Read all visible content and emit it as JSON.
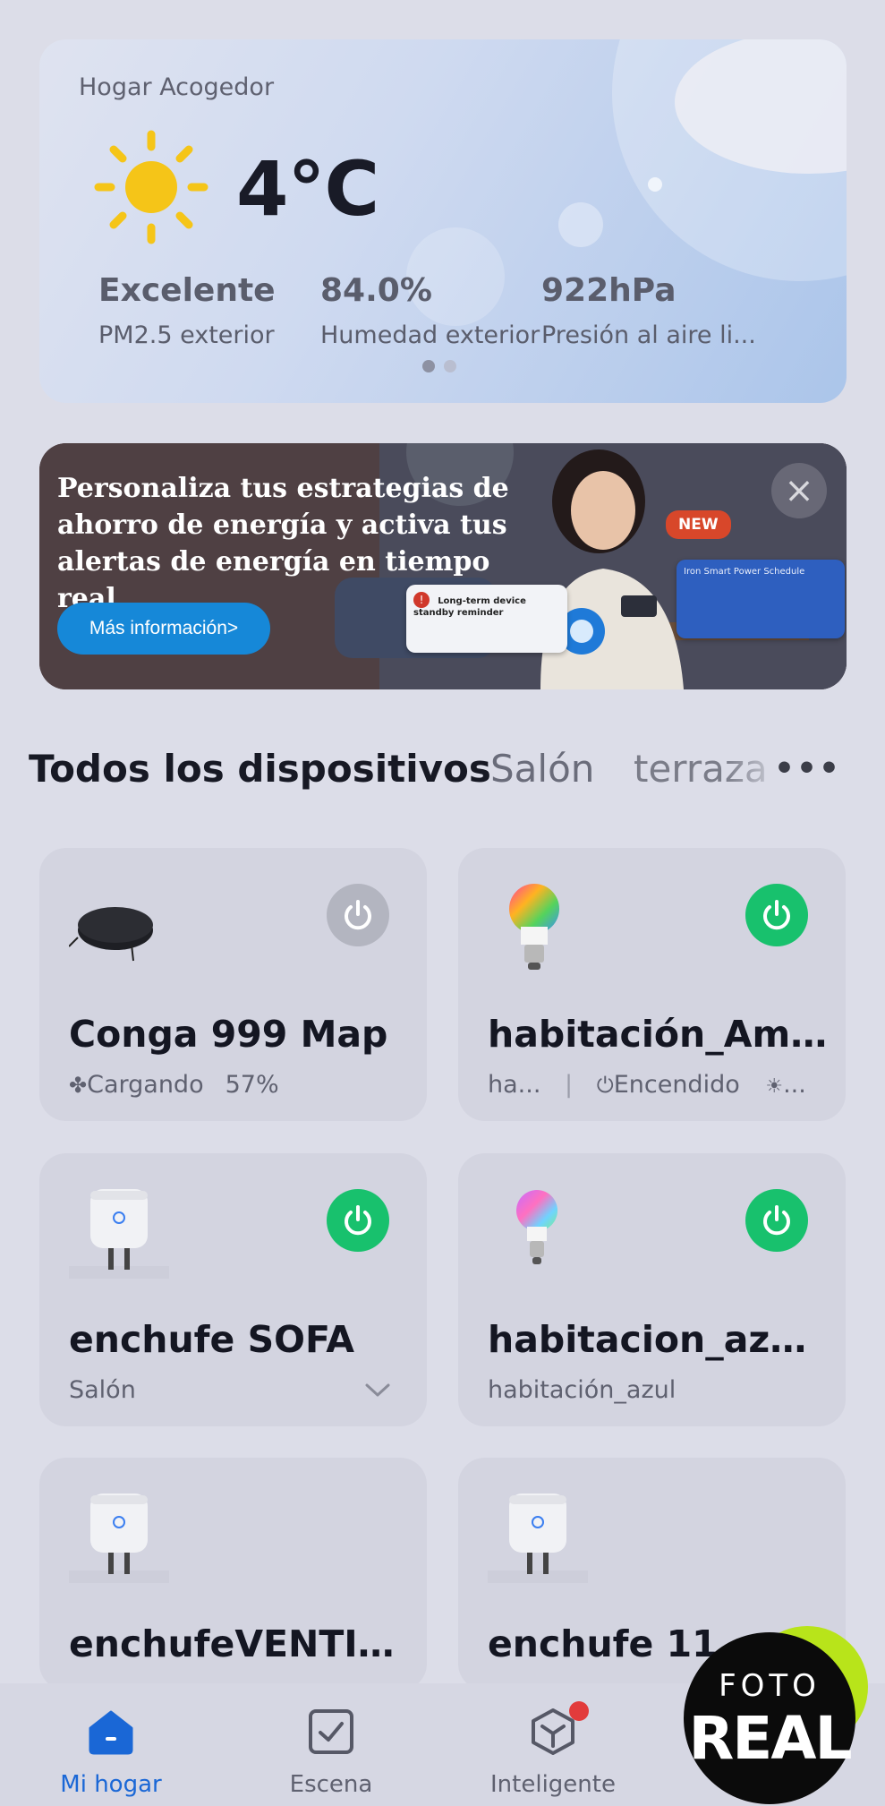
{
  "weather": {
    "home_name": "Hogar Acogedor",
    "temperature": "4°C",
    "icon": "sun-icon",
    "stats": [
      {
        "value": "Excelente",
        "label": "PM2.5 exterior"
      },
      {
        "value": "84.0%",
        "label": "Humedad exterior"
      },
      {
        "value": "922hPa",
        "label": "Presión al aire li..."
      }
    ],
    "page_dots": {
      "count": 2,
      "active": 0
    }
  },
  "banner": {
    "headline_lines": [
      "Personaliza tus estrategias de",
      "ahorro de energía y activa tus",
      "alertas de energía en tiempo real"
    ],
    "cta": "Más información>",
    "tag": "NEW",
    "mini_card_1": "Long-term device standby reminder",
    "mini_card_2": "Iron Smart Power Schedule"
  },
  "tabs": {
    "items": [
      "Todos los dispositivos",
      "Salón",
      "terraza"
    ],
    "active": 0,
    "more": "•••"
  },
  "devices": [
    {
      "name": "Conga 999 Map",
      "icon": "robot-vacuum-icon",
      "status_icon": "fan-icon",
      "status": "Cargando",
      "extra": "57%",
      "power": "off"
    },
    {
      "name": "habitación_Amar...",
      "icon": "rgb-bulb-icon",
      "room": "ha...",
      "status": "Encendido",
      "extra": "...",
      "power": "on"
    },
    {
      "name": "enchufe SOFA",
      "icon": "smart-plug-icon",
      "room": "Salón",
      "power": "on"
    },
    {
      "name": "habitacion_azul_...",
      "icon": "rgb-bulb-icon",
      "room": "habitación_azul",
      "power": "on"
    },
    {
      "name": "enchufeVENTIL...",
      "icon": "smart-plug-icon",
      "power": "none"
    },
    {
      "name": "enchufe 11",
      "icon": "smart-plug-icon",
      "power": "none"
    }
  ],
  "nav": {
    "items": [
      {
        "label": "Mi hogar",
        "icon": "home-icon",
        "active": true
      },
      {
        "label": "Escena",
        "icon": "scene-check-icon",
        "active": false
      },
      {
        "label": "Inteligente",
        "icon": "smart-cube-icon",
        "active": false,
        "badge": true
      }
    ]
  },
  "watermark": {
    "line1": "FOTO",
    "line2": "REAL"
  },
  "colors": {
    "accent_green": "#18c16d",
    "nav_active": "#1a67d6",
    "cta_blue": "#1688d8"
  }
}
